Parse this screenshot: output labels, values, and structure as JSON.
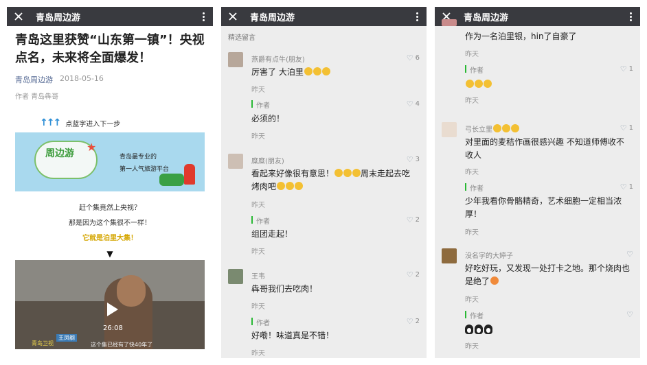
{
  "app": {
    "title": "青岛周边游"
  },
  "article": {
    "title": "青岛这里获赞“山东第一镇”！央视点名，未来将全面爆发！",
    "account": "青岛周边游",
    "date": "2018-05-16",
    "author": "作者  青岛犇哥",
    "prompt": "点蓝字进入下一步",
    "banner": {
      "logo": "周边游",
      "slogan1": "青岛最专业的",
      "slogan2": "第一人气旅游平台"
    },
    "lines": [
      "赶个集竟然上央视？",
      "那是因为这个集很不一样！"
    ],
    "highlight": "它就是泊里大集！",
    "triangle": "▼",
    "video": {
      "duration": "26:08",
      "caption": "王凤纲",
      "caption_sub": "赶集的",
      "subtitle": "这个集已经有了快40年了",
      "watermark": "青岛卫视"
    }
  },
  "comments_panel": {
    "section_title": "精选留言",
    "comments": [
      {
        "nick": "燕爵有点牛(朋友)",
        "likes": "6",
        "text": "厉害了 大泊里",
        "emoji_count": 3,
        "time": "昨天",
        "reply_label": "作者",
        "reply_likes": "4",
        "reply_text": "必须的！",
        "reply_time": "昨天"
      },
      {
        "nick": "糜糜(朋友)",
        "likes": "3",
        "text_a": "看起来好像很有意思！",
        "text_b": "周末走起去吃烤肉吧",
        "time": "昨天",
        "reply_label": "作者",
        "reply_likes": "2",
        "reply_text": "组团走起！",
        "reply_time": "昨天"
      },
      {
        "nick": "王韦",
        "likes": "2",
        "text": "犇哥我们去吃肉！",
        "time": "昨天",
        "reply_label": "作者",
        "reply_likes": "2",
        "reply_text": "好嘞！味道真是不错！",
        "reply_time": "昨天"
      }
    ]
  },
  "comments_panel_2": {
    "comments": [
      {
        "text": "作为一名泊里银，hin了自豪了",
        "time": "昨天",
        "reply_label": "作者",
        "reply_likes": "1",
        "reply_time": "昨天"
      },
      {
        "nick": "弓长立里",
        "likes": "1",
        "text": "对里面的麦秸作画很感兴趣 不知道师傅收不收人",
        "time": "昨天",
        "reply_label": "作者",
        "reply_likes": "1",
        "reply_text": "少年我看你骨骼精奇，艺术细胞一定相当浓厚！",
        "reply_time": "昨天"
      },
      {
        "nick": "没名字的大婷子",
        "text": "好吃好玩，又发现一处打卡之地。那个烧肉也是绝了",
        "time": "昨天",
        "reply_label": "作者",
        "reply_time": "昨天"
      }
    ]
  },
  "icons": {
    "close": "close-icon",
    "more": "more-vertical-icon",
    "like": "heart-icon"
  },
  "colors": {
    "topbar": "#393a3f",
    "link": "#576b95",
    "author_bar": "#28b833",
    "highlight": "#d5a600"
  }
}
